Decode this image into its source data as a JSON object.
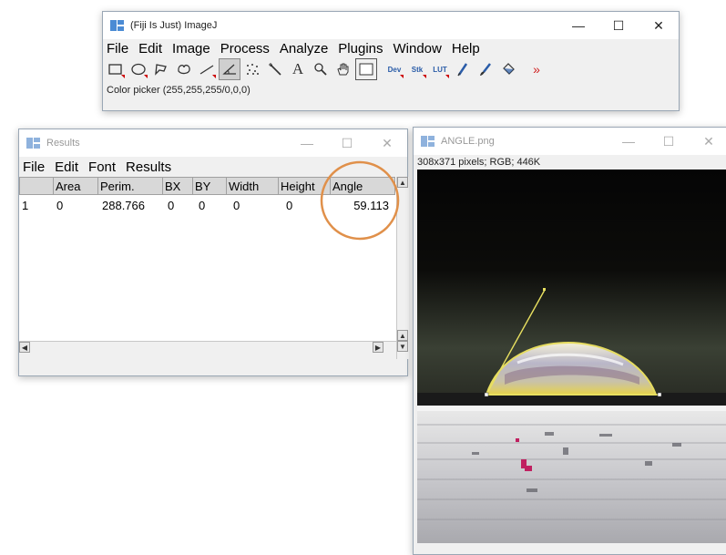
{
  "imagej": {
    "title": "(Fiji Is Just) ImageJ",
    "menu": [
      "File",
      "Edit",
      "Image",
      "Process",
      "Analyze",
      "Plugins",
      "Window",
      "Help"
    ],
    "tools": [
      "rectangle-tool",
      "oval-tool",
      "polygon-tool",
      "freehand-tool",
      "line-tool",
      "angle-tool",
      "point-tool",
      "wand-tool",
      "text-tool",
      "magnifier-tool",
      "hand-tool",
      "color-picker-tool",
      "dev-menu",
      "stk-menu",
      "lut-menu",
      "pencil-tool",
      "brush-tool",
      "flood-fill-tool",
      "more-tools"
    ],
    "tool_labels": {
      "text": "A",
      "dev": "Dev",
      "stk": "Stk",
      "lut": "LUT",
      "more": "»"
    },
    "status": "Color picker (255,255,255/0,0,0)",
    "controls": {
      "minimize": "—",
      "maximize": "☐",
      "close": "✕"
    }
  },
  "results": {
    "title": "Results",
    "menu": [
      "File",
      "Edit",
      "Font",
      "Results"
    ],
    "columns": [
      "",
      "Area",
      "Perim.",
      "BX",
      "BY",
      "Width",
      "Height",
      "Angle"
    ],
    "rows": [
      [
        "1",
        "0",
        "288.766",
        "0",
        "0",
        "0",
        "0",
        "59.113"
      ]
    ],
    "controls": {
      "minimize": "—",
      "maximize": "☐",
      "close": "✕"
    }
  },
  "image_window": {
    "title": "ANGLE.png",
    "info": "308x371 pixels; RGB; 446K",
    "controls": {
      "minimize": "—",
      "maximize": "☐",
      "close": "✕"
    }
  },
  "colors": {
    "highlight_circle": "#e0904a",
    "angle_line": "#e8e060",
    "selected_tool_bg": "#cfcfcf"
  }
}
